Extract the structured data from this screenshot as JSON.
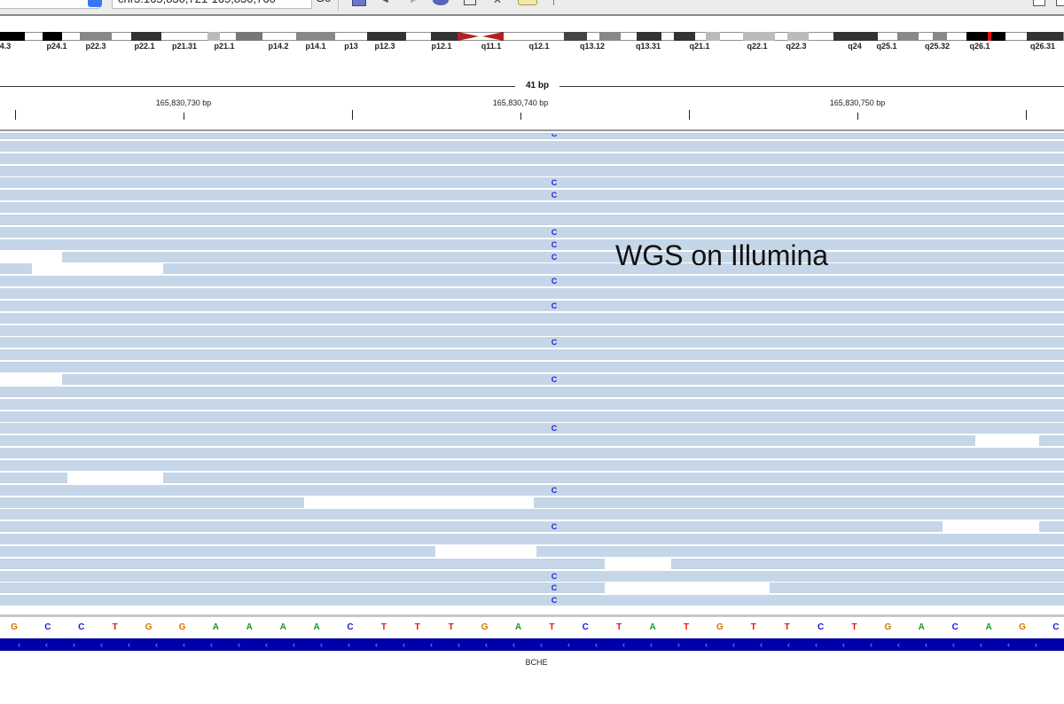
{
  "toolbar": {
    "locus": "chr3:165,830,721-165,830,760",
    "go_label": "Go"
  },
  "ideogram": {
    "bands": [
      "4.3",
      "p24.1",
      "p22.3",
      "p22.1",
      "p21.31",
      "p21.1",
      "p14.2",
      "p14.1",
      "p13",
      "p12.3",
      "p12.1",
      "q11.1",
      "q12.1",
      "q13.12",
      "q13.31",
      "q21.1",
      "q22.1",
      "q22.3",
      "q24",
      "q25.1",
      "q25.32",
      "q26.1",
      "q26.31"
    ]
  },
  "ruler": {
    "span": "41 bp",
    "ticks": [
      "165,830,730 bp",
      "165,830,740 bp",
      "165,830,750 bp"
    ]
  },
  "alignment": {
    "mismatch_base": "C",
    "read_count": 38,
    "mismatch_rows": [
      0,
      4,
      5,
      8,
      9,
      10,
      12,
      14,
      17,
      20,
      24,
      29,
      32,
      36,
      37,
      38
    ]
  },
  "annotation": "WGS on Illumina",
  "sequence": {
    "bases": [
      "G",
      "C",
      "C",
      "T",
      "G",
      "G",
      "A",
      "A",
      "A",
      "A",
      "C",
      "T",
      "T",
      "T",
      "G",
      "A",
      "T",
      "C",
      "T",
      "A",
      "T",
      "G",
      "T",
      "T",
      "C",
      "T",
      "G",
      "A",
      "C",
      "A",
      "G",
      "C"
    ],
    "colors": {
      "A": "#1a9a1a",
      "C": "#1a1acc",
      "G": "#cc7a00",
      "T": "#dd1a1a"
    }
  },
  "gene": {
    "name": "BCHE",
    "color": "#0000a8"
  }
}
